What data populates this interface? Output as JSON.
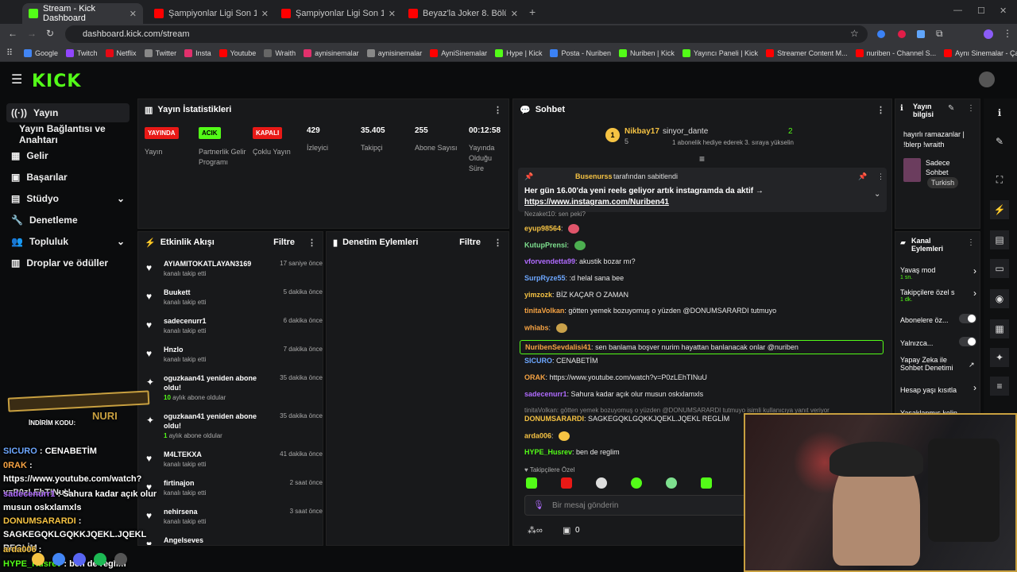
{
  "browser": {
    "tabs": [
      {
        "title": "Stream - Kick Dashboard",
        "active": true
      },
      {
        "title": "Şampiyonlar Ligi Son 16 Play-o",
        "active": false
      },
      {
        "title": "Şampiyonlar Ligi Son 16 Play-o",
        "active": false
      },
      {
        "title": "Beyaz'la Joker 8. Bölüm - YouTu",
        "active": false
      }
    ],
    "url": "dashboard.kick.com/stream",
    "bookmarks": [
      "Google",
      "Twitch",
      "Netflix",
      "Twitter",
      "Insta",
      "Youtube",
      "Wraith",
      "aynisinemalar",
      "aynisinemalar",
      "AyniSinemalar",
      "Hype | Kick",
      "Posta - Nuriben",
      "Nuriben | Kick",
      "Yayıncı Paneli | Kick",
      "Streamer Content M...",
      "nuriben - Channel S...",
      "Aynı Sinemalar - Ça..."
    ]
  },
  "sidebar": {
    "items": [
      "Yayın",
      "Yayın Bağlantısı ve Anahtarı",
      "Gelir",
      "Başarılar",
      "Stüdyo",
      "Denetleme",
      "Topluluk",
      "Droplar ve ödüller"
    ]
  },
  "stats": {
    "title": "Yayın İstatistikleri",
    "cols": [
      {
        "badge": "YAYINDA",
        "label": "Yayın"
      },
      {
        "badge": "ACIK",
        "label": "Partnerlik Gelir Programı"
      },
      {
        "badge": "KAPALI",
        "label": "Çoklu Yayın"
      },
      {
        "value": "429",
        "label": "İzleyici"
      },
      {
        "value": "35.405",
        "label": "Takipçi"
      },
      {
        "value": "255",
        "label": "Abone Sayısı"
      },
      {
        "value": "00:12:58",
        "label": "Yayında Olduğu Süre"
      }
    ]
  },
  "activity": {
    "title": "Etkinlik Akışı",
    "filter": "Filtre",
    "items": [
      {
        "name": "AYIAMITOKATLAYAN3169",
        "sub": "kanalı takip etti",
        "time": "17 saniye önce",
        "icon": "♥"
      },
      {
        "name": "Buukett",
        "sub": "kanalı takip etti",
        "time": "5 dakika önce",
        "icon": "♥"
      },
      {
        "name": "sadecenurr1",
        "sub": "kanalı takip etti",
        "time": "6 dakika önce",
        "icon": "♥"
      },
      {
        "name": "Hnzlo",
        "sub": "kanalı takip etti",
        "time": "7 dakika önce",
        "icon": "♥"
      },
      {
        "name": "oguzkaan41 yeniden abone oldu!",
        "subnum": "10",
        "sub": "aylık abone oldular",
        "time": "35 dakika önce",
        "icon": "✦"
      },
      {
        "name": "oguzkaan41 yeniden abone oldu!",
        "subnum": "1",
        "sub": "aylık abone oldular",
        "time": "35 dakika önce",
        "icon": "✦"
      },
      {
        "name": "M4LTEKXA",
        "sub": "kanalı takip etti",
        "time": "41 dakika önce",
        "icon": "♥"
      },
      {
        "name": "firtinajon",
        "sub": "kanalı takip etti",
        "time": "2 saat önce",
        "icon": "♥"
      },
      {
        "name": "nehirsena",
        "sub": "kanalı takip etti",
        "time": "3 saat önce",
        "icon": "♥"
      },
      {
        "name": "Angelseves",
        "sub": "",
        "time": "",
        "icon": "♥"
      }
    ]
  },
  "moderation": {
    "title": "Denetim Eylemleri",
    "filter": "Filtre"
  },
  "chat": {
    "title": "Sohbet",
    "top": {
      "user1": "Nikbay17",
      "count1": "5",
      "user2": "sinyor_dante",
      "count2": "2",
      "note": "1 abonelik hediye ederek 3. sıraya yükselin"
    },
    "pinned": {
      "by": "Busenurss",
      "byText": "tarafından sabitlendi",
      "text": "Her gün 16.00'da yeni reels geliyor artık instagramda da aktif →",
      "link": "https://www.instagram.com/Nuriben41"
    },
    "partial": "Nezaket10: sen peki?",
    "messages": [
      {
        "user": "eyup98564",
        "color": "#f6c343",
        "text": ""
      },
      {
        "user": "KutupPrensi",
        "color": "#7ee08f",
        "text": ""
      },
      {
        "user": "vforvendetta99",
        "color": "#b06bff",
        "text": "akustik bozar mı?"
      },
      {
        "user": "SurpRyze55",
        "color": "#6da7ff",
        "text": ":d helal sana bee"
      },
      {
        "user": "yimzozk",
        "color": "#f6c343",
        "text": "BİZ KAÇAR O ZAMAN"
      },
      {
        "user": "tinitaVolkan",
        "color": "#f6a343",
        "text": "götten yemek bozuyomuş o yüzden @DONUMSARARDI tutmuyo"
      },
      {
        "user": "whiabs",
        "color": "#f6a343",
        "text": ""
      },
      {
        "user": "NuribenSevdalisi41",
        "color": "#f6a343",
        "text": "sen banlama boşver nurim hayattan banlanacak onlar @nuriben"
      },
      {
        "user": "SICURO",
        "color": "#6da7ff",
        "text": "CENABETİM"
      },
      {
        "user": "ORAK",
        "color": "#f6a343",
        "text": "https://www.youtube.com/watch?v=P0zLEhTINuU"
      },
      {
        "user": "sadecenurr1",
        "color": "#b06bff",
        "text": "Sahura kadar açık olur musun oskxlamxls"
      },
      {
        "user": "DONUMSARARDI",
        "color": "#f6c343",
        "text": "SAGKEGQKLGQKKJQEKL.JQEKL REGLİM"
      },
      {
        "user": "arda006",
        "color": "#f6c343",
        "text": ""
      },
      {
        "user": "HYPE_Husrev",
        "color": "#53fc18",
        "text": "ben de reglim"
      }
    ],
    "reply": "tinitaVolkan: götten yemek bozuyomuş o yüzden @DONUMSARARDI tutmuyo isimli kullanıcıya yanıt veriyor",
    "followers_only": "Takipçilere Özel",
    "input_placeholder": "Bir mesaj gönderin",
    "points": "0"
  },
  "stream_info": {
    "title": "Yayın bilgisi",
    "text": "hayırlı ramazanlar | !blerp !wraith",
    "category": "Sadece Sohbet",
    "language": "Turkish"
  },
  "channel_actions": {
    "title": "Kanal Eylemleri",
    "items": [
      {
        "label": "Yavaş mod",
        "sub": "1 sn."
      },
      {
        "label": "Takipçilere özel s",
        "sub": "1 dk."
      },
      {
        "label": "Abonelere öz...",
        "sub": ""
      },
      {
        "label": "Yalnızca...",
        "sub": ""
      },
      {
        "label": "Yapay Zeka ile Sohbet Denetimi",
        "sub": ""
      },
      {
        "label": "Hesap yaşı kısıtla",
        "sub": ""
      },
      {
        "label": "Yasaklanmış kelin",
        "sub": ""
      }
    ]
  },
  "overlay": {
    "promo": "İNDİRİM KODU:",
    "brand": "NURI",
    "lines": [
      {
        "user": "SICURO",
        "text": "CENABETİM",
        "color": "#6da7ff"
      },
      {
        "user": "0RAK",
        "text": "https://www.youtube.com/watch?v=P0zLEhTINuU",
        "color": "#f6a343"
      },
      {
        "user": "sadecenurr1",
        "text": "Sahura kadar açık olur musun oskxlamxls",
        "color": "#b06bff"
      },
      {
        "user": "DONUMSARARDI",
        "text": "SAGKEGQKLGQKKJQEKL.JQEKL REGLİM",
        "color": "#f6c343"
      },
      {
        "user": "arda006",
        "text": "",
        "color": "#f6c343"
      },
      {
        "user": "HYPE_Husrev",
        "text": "ben de reglim",
        "color": "#53fc18"
      }
    ]
  },
  "colors": {
    "accent": "#53fc18",
    "live": "#e91916",
    "panel": "#18191b"
  }
}
